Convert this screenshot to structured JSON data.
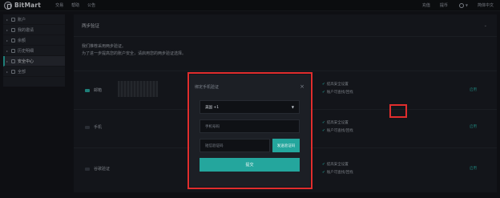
{
  "nav": {
    "logo": "BitMart",
    "links": [
      "交易",
      "帮助",
      "公告"
    ],
    "right_links": [
      "充值",
      "提币"
    ],
    "language": "简体中文"
  },
  "sidebar": {
    "items": [
      {
        "label": "账户"
      },
      {
        "label": "我的邀请"
      },
      {
        "label": "余额"
      },
      {
        "label": "历史明细"
      },
      {
        "label": "安全中心"
      },
      {
        "label": "全部"
      }
    ]
  },
  "main": {
    "title": "两步验证",
    "intro_line1": "我们推荐采用两步验证。",
    "intro_line2": "为了进一步提高您的账户安全，请启用您的两步验证选择。",
    "rows": [
      {
        "label": "邮箱",
        "checks": [
          "提高安全设置",
          "账户可查找/回找"
        ],
        "action": "启用"
      },
      {
        "label": "手机",
        "checks": [
          "提高安全设置",
          "账户可查找/回找"
        ],
        "action": "启用"
      },
      {
        "label": "谷歌验证",
        "checks": [
          "提高安全设置",
          "账户可查找/回找"
        ],
        "action": "启用"
      }
    ]
  },
  "modal": {
    "title": "绑定手机验证",
    "close": "×",
    "country": "美国 +1",
    "phone_placeholder": "手机号码",
    "code_placeholder": "短信验证码",
    "send_code": "发送验证码",
    "submit": "提交"
  },
  "colors": {
    "accent": "#24a69d",
    "highlight": "#e02d2d",
    "background": "#14161b"
  }
}
